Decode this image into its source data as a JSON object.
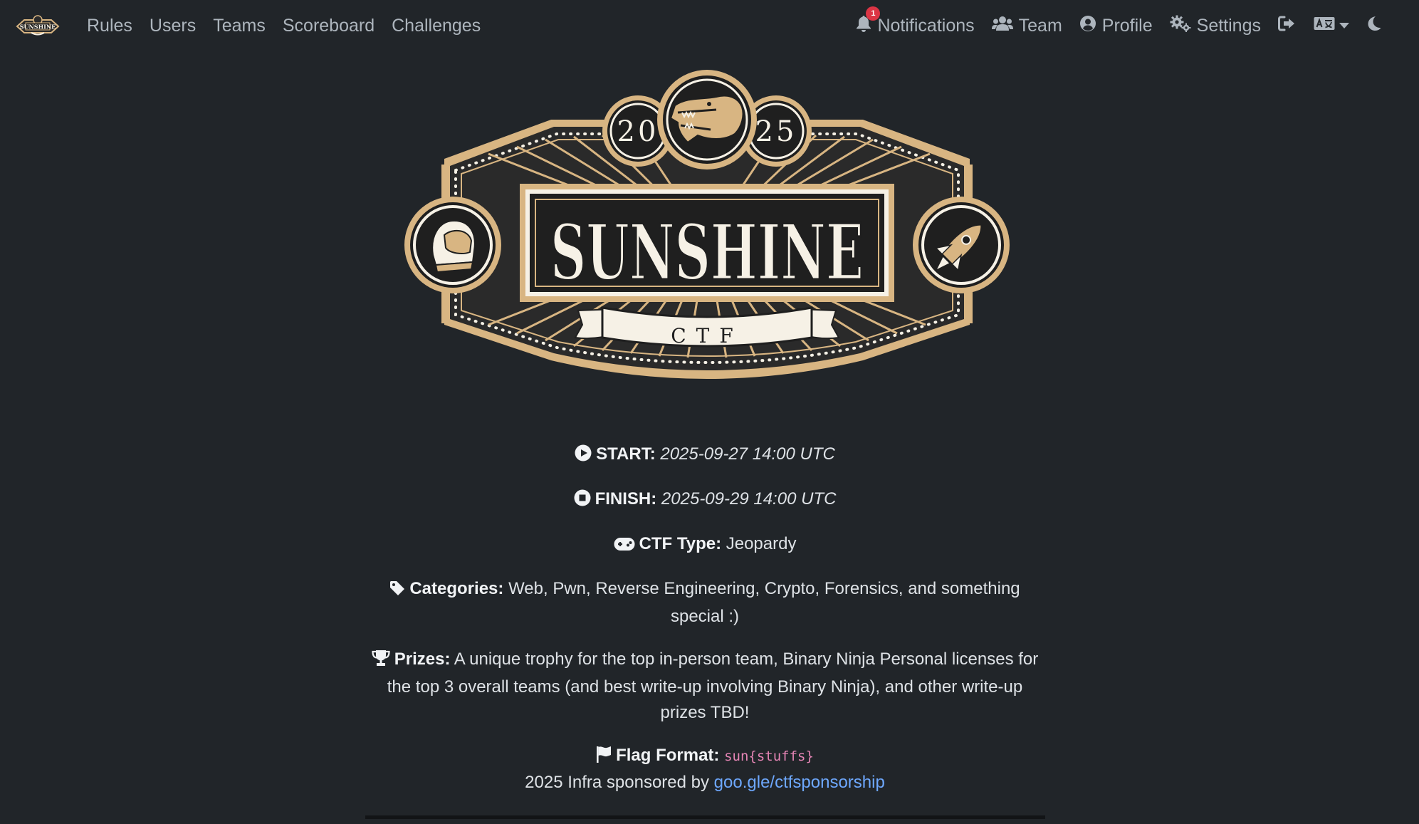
{
  "nav": {
    "brand_icon": "sunshine-ctf-logo",
    "links": [
      "Rules",
      "Users",
      "Teams",
      "Scoreboard",
      "Challenges"
    ],
    "notifications_label": "Notifications",
    "notifications_count": "1",
    "team_label": "Team",
    "profile_label": "Profile",
    "settings_label": "Settings",
    "icons": {
      "notifications": "bell-icon",
      "team": "users-icon",
      "profile": "user-circle-icon",
      "settings": "gears-icon",
      "logout": "logout-icon",
      "language": "language-icon",
      "theme": "moon-icon"
    }
  },
  "logo": {
    "year_left": "20",
    "year_right": "25",
    "title": "SUNSHINE",
    "ribbon": "CTF",
    "colors": {
      "gold": "#d8b582",
      "dark": "#1f1f1f",
      "cream": "#f6f1e6"
    }
  },
  "info": {
    "start_label": "START:",
    "start_value": "2025-09-27 14:00 UTC",
    "finish_label": "FINISH:",
    "finish_value": "2025-09-29 14:00 UTC",
    "type_label": "CTF Type:",
    "type_value": "Jeopardy",
    "categories_label": "Categories:",
    "categories_value": "Web, Pwn, Reverse Engineering, Crypto, Forensics, and something special :)",
    "prizes_label": "Prizes:",
    "prizes_value": "A unique trophy for the top in-person team, Binary Ninja Personal licenses for the top 3 overall teams (and best write-up involving Binary Ninja), and other write-up prizes TBD!",
    "flag_label": "Flag Format:",
    "flag_value": "sun{stuffs}"
  },
  "sponsor": {
    "text": "2025 Infra sponsored by",
    "link": "goo.gle/ctfsponsorship"
  },
  "colors": {
    "background": "#212529",
    "link": "#6ea8fe",
    "code": "#e685b5",
    "badge": "#dc3545"
  }
}
